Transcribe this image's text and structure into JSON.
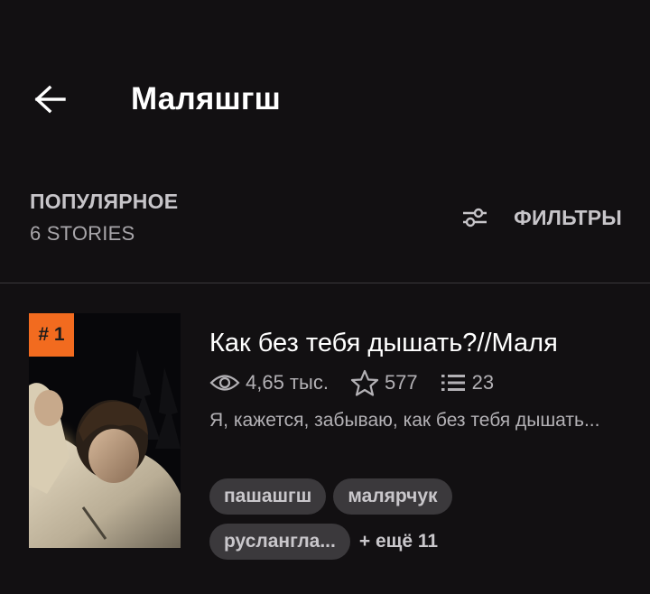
{
  "header": {
    "title": "Маляшгш",
    "back_icon": "arrow-left-icon"
  },
  "section": {
    "title": "ПОПУЛЯРНОЕ",
    "count": "6 STORIES",
    "filters_label": "ФИЛЬТРЫ",
    "filters_icon": "sliders-icon"
  },
  "story": {
    "rank": "# 1",
    "title": "Как без тебя дышать?//Маля",
    "reads": "4,65 тыс.",
    "votes": "577",
    "parts": "23",
    "description": "Я, кажется, забываю, как без тебя дышать...",
    "tags": [
      "пашашгш",
      "малярчук",
      "русланглa..."
    ],
    "more_tags": "+ ещё 11",
    "cover_image": "portrait photo of young man in light jacket at night"
  },
  "colors": {
    "background": "#121012",
    "accent_badge": "#f26b1f",
    "tag_bg": "#3b393c",
    "muted_text": "#b3b1b5"
  }
}
